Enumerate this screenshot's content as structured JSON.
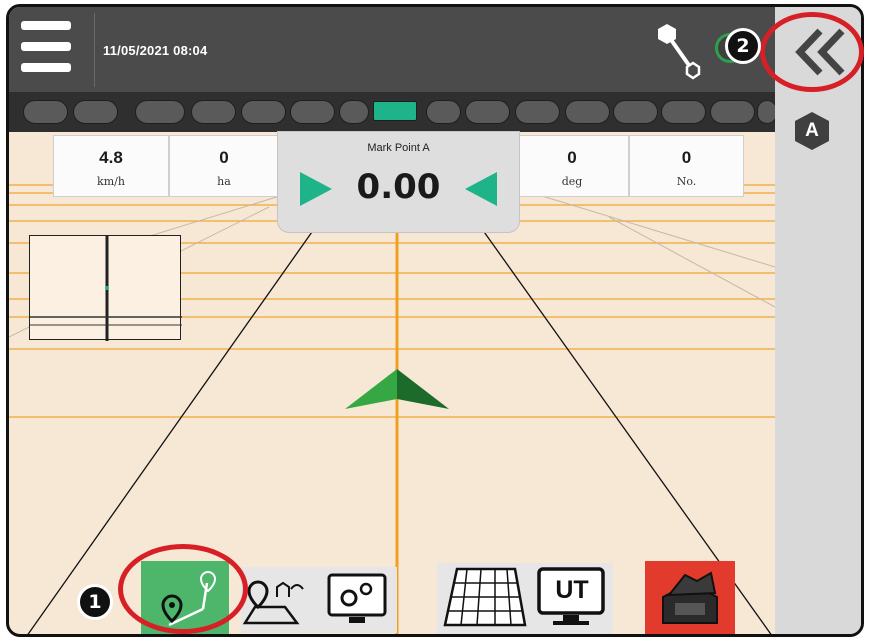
{
  "header": {
    "datetime": "11/05/2021 08:04"
  },
  "guidance": {
    "mark_label": "Mark Point A",
    "cross_track": "0.00"
  },
  "info_boxes": [
    {
      "value": "4.8",
      "unit": "km/h"
    },
    {
      "value": "0",
      "unit": "ha"
    },
    {
      "value": "0",
      "unit": "deg"
    },
    {
      "value": "0",
      "unit": "No."
    }
  ],
  "sections": {
    "count": 16,
    "active_index": 8
  },
  "right_panel": {
    "auto_label": "A"
  },
  "bottom_toolbar": {
    "ut_label": "UT"
  },
  "annotations": [
    {
      "number": "1"
    },
    {
      "number": "2"
    }
  ],
  "colors": {
    "accent_green": "#1fb38a",
    "annotation_red": "#d71f26",
    "guideline_orange": "#f0a020",
    "field": "#f7e8d6",
    "topbar": "#4b4b4b"
  },
  "icons": [
    "menu-icon",
    "gps-receiver-icon",
    "gps-status-icon",
    "collapse-chevron-icon",
    "auto-steer-a-icon",
    "guidance-mode-icon",
    "field-boundary-icon",
    "system-settings-icon",
    "coverage-map-icon",
    "ut-terminal-icon",
    "job-storage-icon"
  ]
}
